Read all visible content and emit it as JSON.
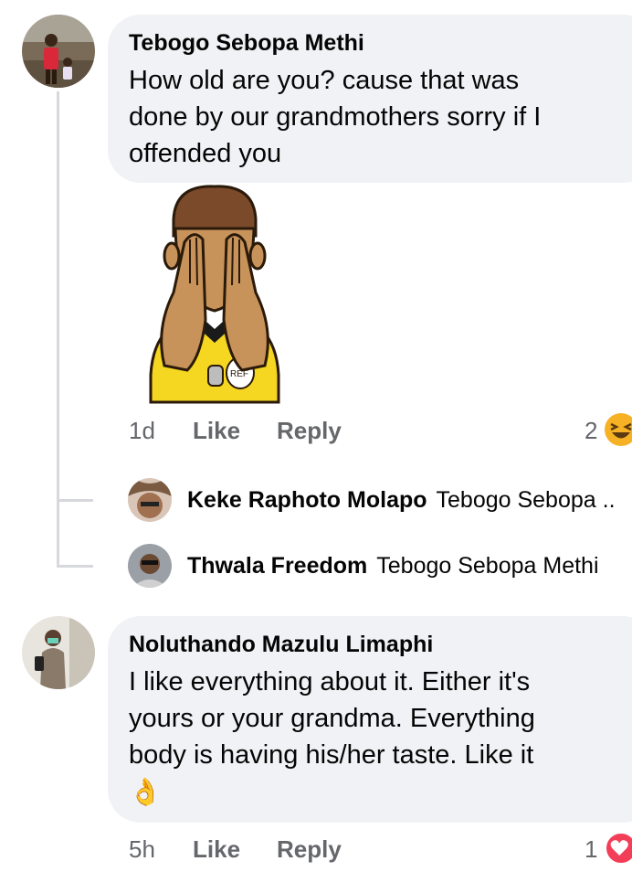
{
  "comments": [
    {
      "author": "Tebogo Sebopa Methi",
      "text_lines": [
        "How old are you? cause that was",
        "done by our grandmothers sorry if I",
        "offended you"
      ],
      "time": "1d",
      "like_label": "Like",
      "reply_label": "Reply",
      "reaction_count": "2",
      "reaction_icon": "haha-emoji-icon",
      "sticker": {
        "icon": "referee-covering-eyes-sticker",
        "badge_text": "REF"
      }
    },
    {
      "author": "Noluthando Mazulu Limaphi",
      "text_lines": [
        "I like everything about it. Either it's",
        "yours or your grandma. Everything",
        "body is having his/her taste. Like it"
      ],
      "emoji": "👌",
      "time": "5h",
      "like_label": "Like",
      "reply_label": "Reply",
      "reaction_count": "1",
      "reaction_icon": "love-heart-icon"
    }
  ],
  "replies": [
    {
      "author": "Keke Raphoto Molapo",
      "mention": "Tebogo Sebopa .."
    },
    {
      "author": "Thwala Freedom",
      "mention": "Tebogo Sebopa Methi"
    }
  ],
  "colors": {
    "bubble": "#f0f2f5",
    "secondary_text": "#65676b",
    "thread_line": "#d6d8dc",
    "haha": "#f7b125",
    "love": "#f33e58"
  }
}
